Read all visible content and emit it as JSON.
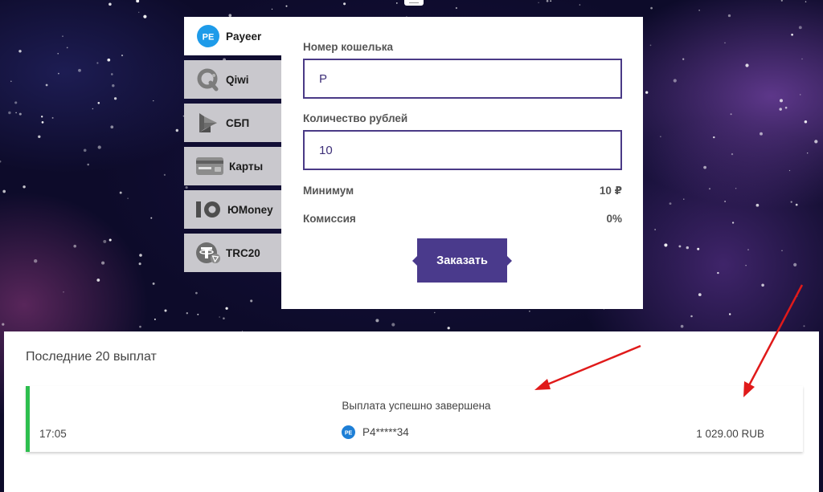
{
  "methods": [
    {
      "label": "Payeer",
      "icon": "payeer-icon",
      "active": true
    },
    {
      "label": "Qiwi",
      "icon": "qiwi-icon",
      "active": false
    },
    {
      "label": "СБП",
      "icon": "sbp-icon",
      "active": false
    },
    {
      "label": "Карты",
      "icon": "card-icon",
      "active": false
    },
    {
      "label": "ЮMoney",
      "icon": "yoomoney-icon",
      "active": false
    },
    {
      "label": "TRC20",
      "icon": "tether-tron-icon",
      "active": false
    }
  ],
  "payeer_badge": "PE",
  "form": {
    "wallet_label": "Номер кошелька",
    "wallet_value": "P",
    "amount_label": "Количество рублей",
    "amount_value": "10",
    "min_label": "Минимум",
    "min_value": "10 ₽",
    "fee_label": "Комиссия",
    "fee_value": "0%",
    "order_button": "Заказать"
  },
  "payouts": {
    "title": "Последние 20 выплат",
    "items": [
      {
        "status": "Выплата успешно завершена",
        "time": "17:05",
        "wallet": "P4*****34",
        "amount": "1 029.00 RUB"
      }
    ]
  },
  "colors": {
    "accent": "#4a3a8c",
    "success": "#2dbe4e",
    "annotation": "#e01a1a"
  }
}
